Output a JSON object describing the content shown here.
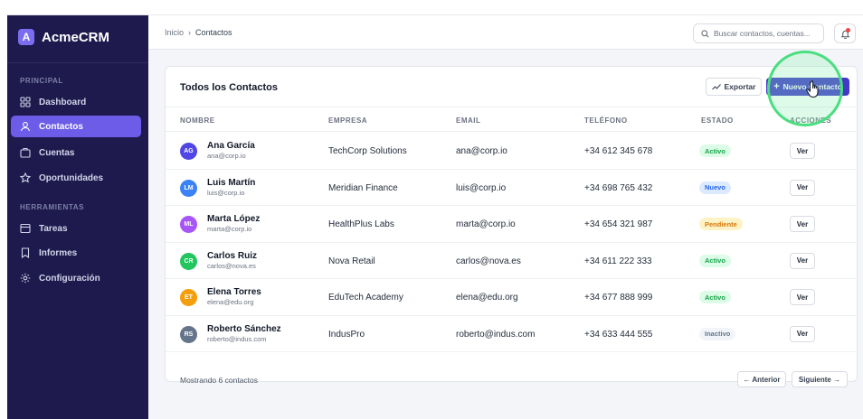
{
  "brand": {
    "logo_letter": "A",
    "name": "AcmeCRM",
    "accent": "#7c6cf0"
  },
  "sidebar": {
    "sections": [
      {
        "label": "PRINCIPAL"
      },
      {
        "label": "HERRAMIENTAS"
      }
    ],
    "items": [
      {
        "label": "Dashboard",
        "icon": "grid-icon"
      },
      {
        "label": "Contactos",
        "icon": "user-icon",
        "active": true
      },
      {
        "label": "Cuentas",
        "icon": "briefcase-icon"
      },
      {
        "label": "Oportunidades",
        "icon": "star-icon"
      },
      {
        "label": "Tareas",
        "icon": "checklist-icon"
      },
      {
        "label": "Informes",
        "icon": "bookmark-icon"
      },
      {
        "label": "Configuración",
        "icon": "gear-icon"
      }
    ]
  },
  "topbar": {
    "breadcrumb": [
      "Inicio",
      "›",
      "Contactos"
    ],
    "search_placeholder": "Buscar contactos, cuentas..."
  },
  "card": {
    "title": "Todos los Contactos",
    "export_label": "Exportar",
    "new_label": "Nuevo Contacto",
    "columns": [
      "NOMBRE",
      "EMPRESA",
      "EMAIL",
      "TELÉFONO",
      "ESTADO",
      "ACCIONES"
    ],
    "rows": [
      {
        "initials": "AG",
        "name": "Ana García",
        "sub": "ana@corp.io",
        "company": "TechCorp Solutions",
        "email": "ana@corp.io",
        "phone": "+34 612 345 678",
        "status": "Activo",
        "action": "Ver",
        "avatar_color": "#4f46e5"
      },
      {
        "initials": "LM",
        "name": "Luis Martín",
        "sub": "luis@corp.io",
        "company": "Meridian Finance",
        "email": "luis@corp.io",
        "phone": "+34 698 765 432",
        "status": "Nuevo",
        "action": "Ver",
        "avatar_color": "#3b82f6"
      },
      {
        "initials": "ML",
        "name": "Marta López",
        "sub": "marta@corp.io",
        "company": "HealthPlus Labs",
        "email": "marta@corp.io",
        "phone": "+34 654 321 987",
        "status": "Pendiente",
        "action": "Ver",
        "avatar_color": "#a855f7"
      },
      {
        "initials": "CR",
        "name": "Carlos Ruiz",
        "sub": "carlos@nova.es",
        "company": "Nova Retail",
        "email": "carlos@nova.es",
        "phone": "+34 611 222 333",
        "status": "Activo",
        "action": "Ver",
        "avatar_color": "#22c55e"
      },
      {
        "initials": "ET",
        "name": "Elena Torres",
        "sub": "elena@edu.org",
        "company": "EduTech Academy",
        "email": "elena@edu.org",
        "phone": "+34 677 888 999",
        "status": "Activo",
        "action": "Ver",
        "avatar_color": "#f59e0b"
      },
      {
        "initials": "RS",
        "name": "Roberto Sánchez",
        "sub": "roberto@indus.com",
        "company": "IndusPro",
        "email": "roberto@indus.com",
        "phone": "+34 633 444 555",
        "status": "Inactivo",
        "action": "Ver",
        "avatar_color": "#64748b"
      }
    ],
    "footer_text": "Mostrando 6 contactos",
    "prev_label": "← Anterior",
    "next_label": "Siguiente →"
  },
  "status_colors": {
    "Activo": {
      "bg": "#dcfce7",
      "fg": "#16a34a"
    },
    "Nuevo": {
      "bg": "#dbeafe",
      "fg": "#2563eb"
    },
    "Pendiente": {
      "bg": "#fef3c7",
      "fg": "#d97706"
    },
    "Inactivo": {
      "bg": "#f1f5f9",
      "fg": "#64748b"
    }
  }
}
